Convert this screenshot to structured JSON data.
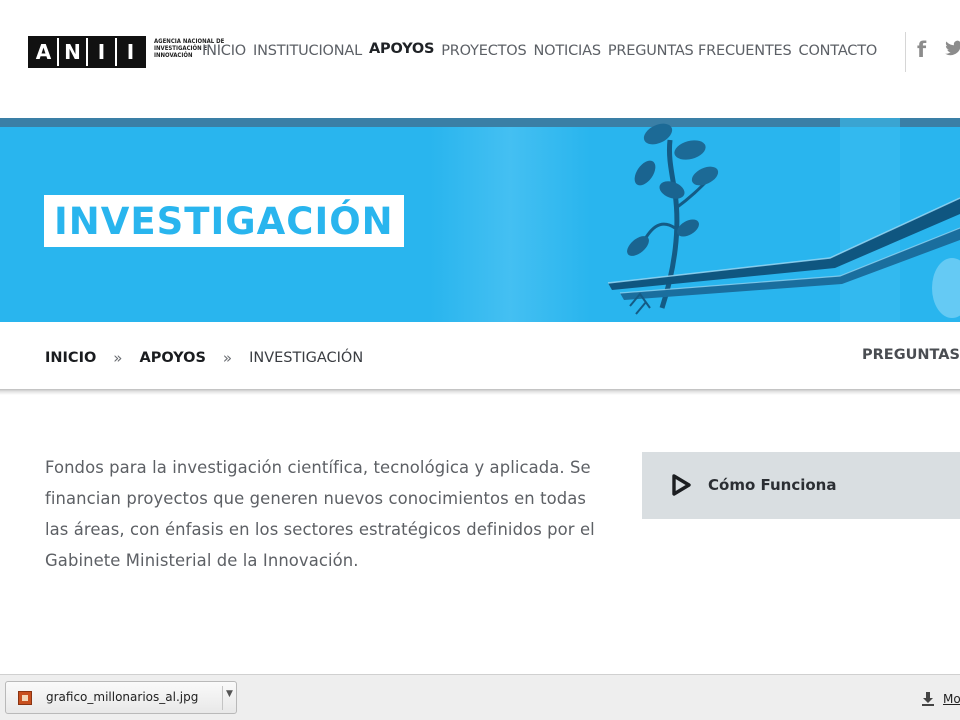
{
  "header": {
    "logo_letters": [
      "A",
      "N",
      "I",
      "I"
    ],
    "logo_subtitle": "AGENCIA NACIONAL DE INVESTIGACIÓN E INNOVACIÓN",
    "nav": [
      {
        "label": "INICIO"
      },
      {
        "label": "INSTITUCIONAL"
      },
      {
        "label": "APOYOS",
        "active": true
      },
      {
        "label": "PROYECTOS"
      },
      {
        "label": "NOTICIAS"
      },
      {
        "label": "PREGUNTAS FRECUENTES"
      },
      {
        "label": "CONTACTO"
      }
    ],
    "social": [
      {
        "icon": "facebook-icon",
        "glyph": "f"
      },
      {
        "icon": "twitter-icon"
      }
    ]
  },
  "hero": {
    "title": "INVESTIGACIÓN",
    "background_color": "#29b5ee"
  },
  "breadcrumb": {
    "items": [
      "INICIO",
      "APOYOS",
      "INVESTIGACIÓN"
    ],
    "separator": "»",
    "right_link": "PREGUNTAS"
  },
  "main": {
    "description_lines": [
      "Fondos para la investigación científica, tecnológica y aplicada. Se",
      "financian proyectos que generen nuevos conocimientos en todas",
      "las áreas, con énfasis en los sectores estratégicos definidos por el",
      "Gabinete Ministerial de la Innovación."
    ],
    "how_it_works_label": "Cómo Funciona"
  },
  "download_bar": {
    "file_name": "grafico_millonarios_al.jpg",
    "show_all_label": "Mo"
  }
}
